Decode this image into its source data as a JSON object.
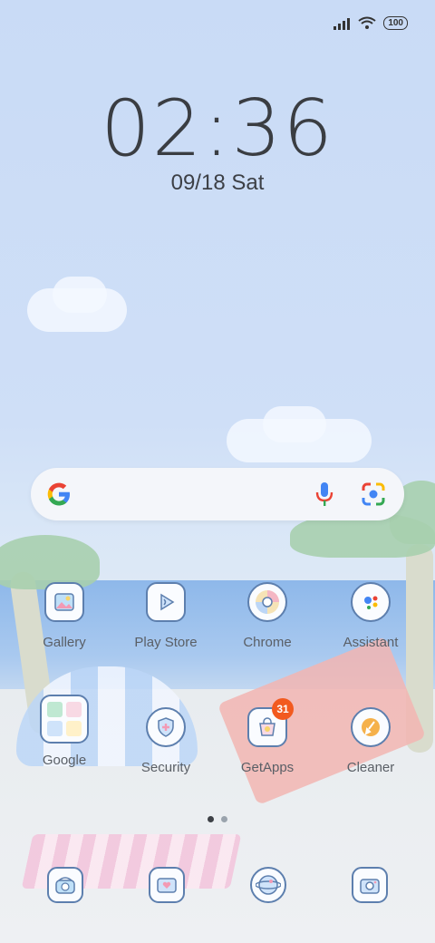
{
  "status_bar": {
    "battery": "100"
  },
  "lock": {
    "time": "02:36",
    "date": "09/18",
    "day": "Sat"
  },
  "search": {},
  "apps_row1": [
    {
      "label": "Gallery",
      "icon": "gallery-icon"
    },
    {
      "label": "Play Store",
      "icon": "play-store-icon"
    },
    {
      "label": "Chrome",
      "icon": "chrome-icon"
    },
    {
      "label": "Assistant",
      "icon": "assistant-icon"
    }
  ],
  "apps_row2": [
    {
      "label": "Google",
      "icon": "google-folder-icon"
    },
    {
      "label": "Security",
      "icon": "security-icon"
    },
    {
      "label": "GetApps",
      "icon": "getapps-icon",
      "badge": "31"
    },
    {
      "label": "Cleaner",
      "icon": "cleaner-icon"
    }
  ],
  "dock": [
    {
      "icon": "phone-icon"
    },
    {
      "icon": "messages-icon"
    },
    {
      "icon": "browser-icon"
    },
    {
      "icon": "camera-icon"
    }
  ],
  "colors": {
    "badge": "#f25a1f",
    "icon_outline": "#5d7fae",
    "text": "#5a5f66"
  }
}
